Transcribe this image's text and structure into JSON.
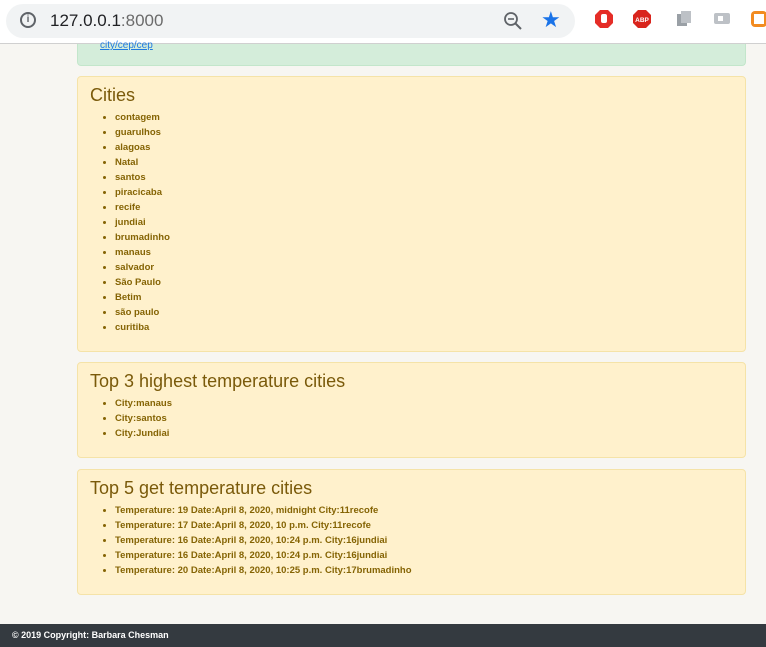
{
  "browser": {
    "url_host": "127.0.0.1",
    "url_port": ":8000"
  },
  "alert": {
    "link_text": "city/cep/cep"
  },
  "cities": {
    "title": "Cities",
    "items": [
      "contagem",
      "guarulhos",
      "alagoas",
      "Natal",
      "santos",
      "piracicaba",
      "recife",
      "jundiai",
      "brumadinho",
      "manaus",
      "salvador",
      "São Paulo",
      "Betim",
      "são paulo",
      "curitiba"
    ]
  },
  "top3": {
    "title": "Top 3 highest temperature cities",
    "items": [
      "City:manaus",
      "City:santos",
      "City:Jundiai"
    ]
  },
  "top5": {
    "title": "Top 5 get temperature cities",
    "items": [
      "Temperature: 19 Date:April 8, 2020, midnight City:11recofe",
      "Temperature: 17 Date:April 8, 2020, 10 p.m. City:11recofe",
      "Temperature: 16 Date:April 8, 2020, 10:24 p.m. City:16jundiai",
      "Temperature: 16 Date:April 8, 2020, 10:24 p.m. City:16jundiai",
      "Temperature: 20 Date:April 8, 2020, 10:25 p.m. City:17brumadinho"
    ]
  },
  "footer": {
    "text": "© 2019 Copyright: Barbara Chesman"
  },
  "icons": {
    "info": "info-icon",
    "zoom": "zoom-out-icon",
    "star": "bookmark-star-icon",
    "ext_stop": "stop-sign-extension-icon",
    "ext_abp": "adblock-plus-extension-icon",
    "accent_blue": "#1a73e8"
  }
}
